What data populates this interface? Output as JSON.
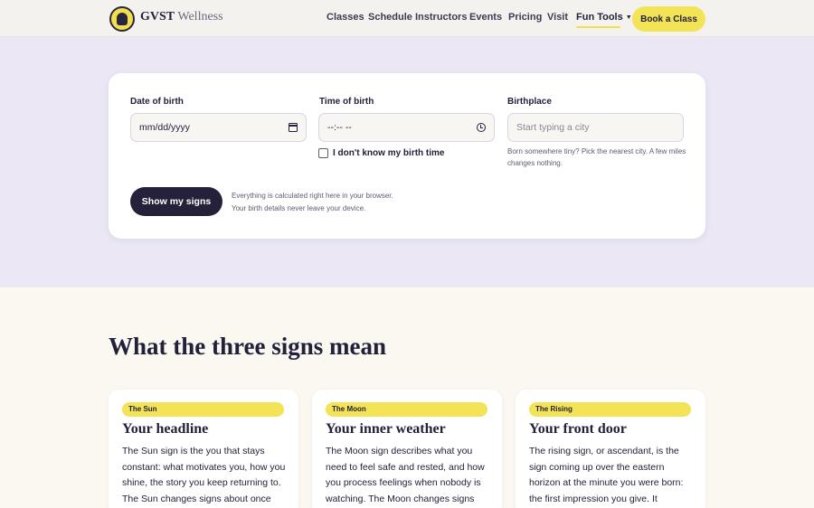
{
  "brand": {
    "name_strong": "GVST",
    "name_light": "Wellness",
    "logo_icon": "lotus-meditation-logo-icon"
  },
  "nav": {
    "items": [
      "Classes",
      "Schedule",
      "Instructors",
      "Events",
      "Pricing",
      "Visit"
    ],
    "fun_tools": "Fun Tools",
    "book": "Book a Class"
  },
  "form": {
    "dob_label": "Date of birth",
    "dob_value": "mm/dd/yyyy",
    "time_label": "Time of birth",
    "time_value": "--:-- --",
    "place_label": "Birthplace",
    "place_placeholder": "Start typing a city",
    "place_hint": "Born somewhere tiny? Pick the nearest city. A few miles changes nothing.",
    "no_time_label": "I don't know my birth time",
    "no_time_checked": false,
    "submit": "Show my signs",
    "privacy_line1": "Everything is calculated right here in your browser.",
    "privacy_line2": "Your birth details never leave your device."
  },
  "signs_section": {
    "title": "What the three signs mean",
    "cards": [
      {
        "tag": "The Sun",
        "heading": "Your headline",
        "body": "The Sun sign is the you that stays constant: what motivates you, how you shine, the story you keep returning to. The Sun changes signs about once"
      },
      {
        "tag": "The Moon",
        "heading": "Your inner weather",
        "body": "The Moon sign describes what you need to feel safe and rested, and how you process feelings when nobody is watching. The Moon changes signs"
      },
      {
        "tag": "The Rising",
        "heading": "Your front door",
        "body": "The rising sign, or ascendant, is the sign coming up over the eastern horizon at the minute you were born: the first impression you give. It"
      }
    ]
  },
  "colors": {
    "accent_yellow": "#f3e356",
    "dark": "#25213a",
    "lavender_band": "#ebe7f5",
    "cream": "#faf8f1"
  }
}
